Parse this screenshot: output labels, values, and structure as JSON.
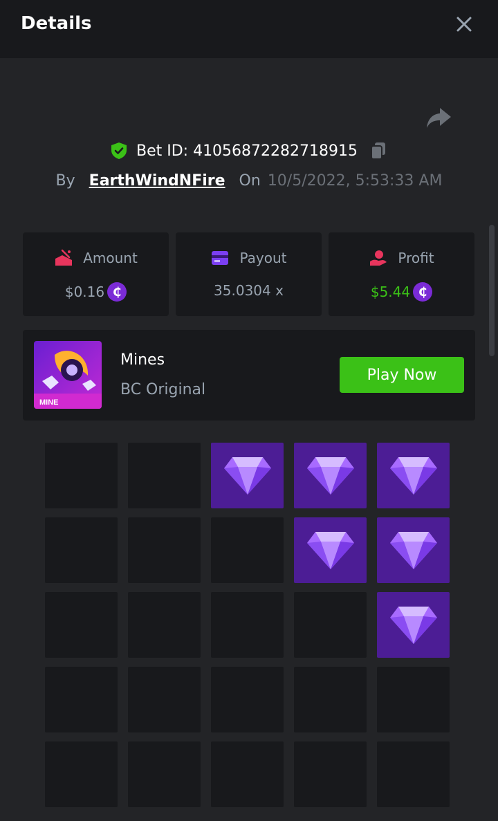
{
  "header": {
    "title": "Details"
  },
  "bet": {
    "id_text": "Bet ID: 41056872282718915",
    "by_label": "By",
    "username": "EarthWindNFire",
    "on_label": "On",
    "datetime": "10/5/2022, 5:53:33 AM"
  },
  "stats": {
    "amount": {
      "label": "Amount",
      "value": "$0.16"
    },
    "payout": {
      "label": "Payout",
      "value": "35.0304 x"
    },
    "profit": {
      "label": "Profit",
      "value": "$5.44"
    }
  },
  "coin_symbol": "₵",
  "game": {
    "name": "Mines",
    "subtitle": "BC Original",
    "thumb_text": "MINE",
    "play_label": "Play Now"
  },
  "board": {
    "rows": 5,
    "cols": 5,
    "tiles": [
      "empty",
      "empty",
      "gem",
      "gem",
      "gem",
      "empty",
      "empty",
      "empty",
      "gem",
      "gem",
      "empty",
      "empty",
      "empty",
      "empty",
      "gem",
      "empty",
      "empty",
      "empty",
      "empty",
      "empty",
      "empty",
      "empty",
      "empty",
      "empty",
      "empty"
    ]
  },
  "colors": {
    "background": "#232427",
    "card": "#18191c",
    "accent_green": "#3bc117",
    "gem_tile": "#4c1d95",
    "coin": "#7b2bd6",
    "muted_text": "#99a4b0"
  },
  "icons": {
    "close": "close-icon",
    "share": "share-icon",
    "verified": "shield-check-icon",
    "copy": "copy-icon",
    "amount": "wager-icon",
    "payout": "card-icon",
    "profit": "hand-profit-icon",
    "coin": "coin-icon",
    "gem": "gem-icon"
  }
}
